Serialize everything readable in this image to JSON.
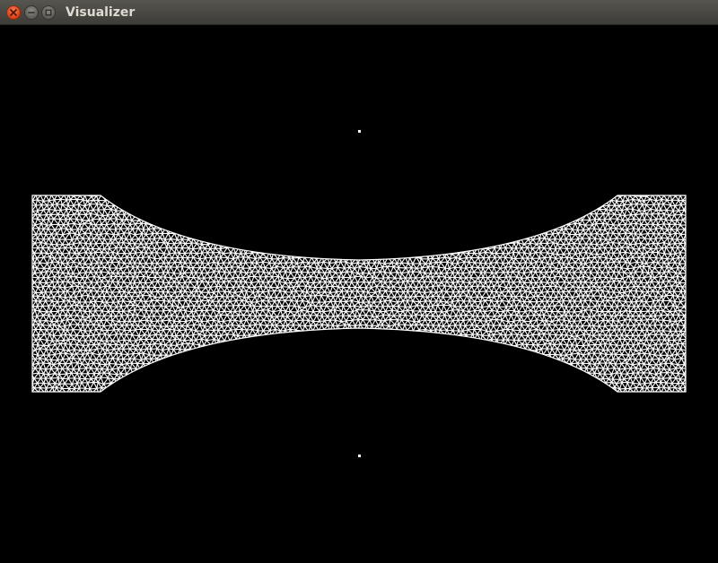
{
  "window": {
    "title": "Visualizer",
    "controls": {
      "close_icon": "close-icon",
      "minimize_icon": "minimize-icon",
      "maximize_icon": "maximize-icon"
    }
  },
  "colors": {
    "background": "#000000",
    "mesh": "#ffffff",
    "close_button": "#e9541f",
    "titlebar": "#4a4945",
    "title_text": "#dfdbd2"
  }
}
